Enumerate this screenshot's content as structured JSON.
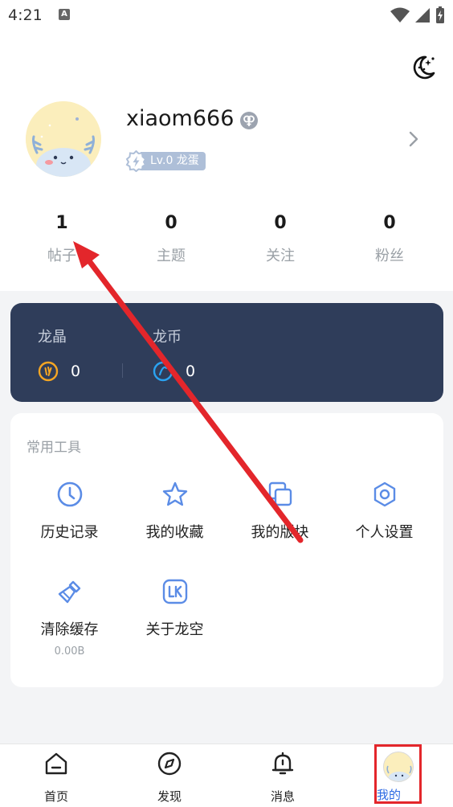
{
  "status": {
    "time": "4:21",
    "a_icon": "A"
  },
  "profile": {
    "username": "xiaom666",
    "level": "Lv.0  龙蛋"
  },
  "stats": [
    {
      "value": "1",
      "label": "帖子"
    },
    {
      "value": "0",
      "label": "主题"
    },
    {
      "value": "0",
      "label": "关注"
    },
    {
      "value": "0",
      "label": "粉丝"
    }
  ],
  "wallet": {
    "crystal": {
      "label": "龙晶",
      "value": "0"
    },
    "coin": {
      "label": "龙币",
      "value": "0"
    }
  },
  "tools": {
    "title": "常用工具",
    "items": [
      {
        "label": "历史记录"
      },
      {
        "label": "我的收藏"
      },
      {
        "label": "我的版块"
      },
      {
        "label": "个人设置"
      },
      {
        "label": "清除缓存",
        "sub": "0.00B"
      },
      {
        "label": "关于龙空"
      }
    ]
  },
  "tabbar": [
    {
      "label": "首页"
    },
    {
      "label": "发现"
    },
    {
      "label": "消息"
    },
    {
      "label": "我的"
    }
  ],
  "colors": {
    "accent": "#2d6ae3",
    "icon_blue": "#5b8ce6",
    "wallet_bg": "#2f3d5a",
    "annotation_red": "#e3262b"
  }
}
